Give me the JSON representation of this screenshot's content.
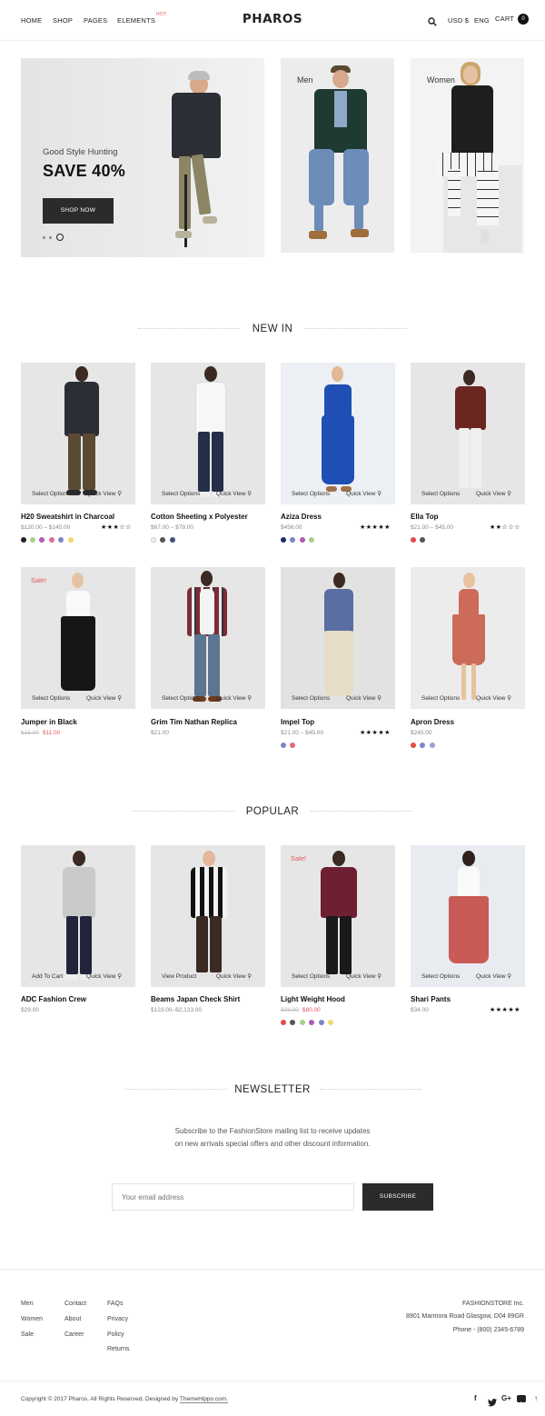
{
  "header": {
    "nav": [
      "HOME",
      "SHOP",
      "PAGES",
      "ELEMENTS"
    ],
    "hot_badge": "HOT",
    "logo": "PHAROS",
    "currency": "USD $",
    "language": "ENG",
    "cart_label": "CART",
    "cart_count": "0"
  },
  "hero": {
    "subtitle": "Good Style Hunting",
    "title": "SAVE 40%",
    "button": "SHOP NOW",
    "men_label": "Men",
    "women_label": "Women"
  },
  "sections": {
    "new_in": "NEW IN",
    "popular": "POPULAR",
    "newsletter": "NEWSLETTER"
  },
  "new_in": [
    {
      "name": "H20 Sweatshirt in Charcoal",
      "price": "$120.00 – $145.00",
      "stars": "★★★☆☆",
      "action": "Select Options",
      "quick": "Quick View",
      "swatches": [
        "#222222",
        "#a8d08d",
        "#b259b7",
        "#e36c9a",
        "#7f84c6",
        "#f5d76e"
      ]
    },
    {
      "name": "Cotton Sheeting x Polyester",
      "price": "$67.00 – $79.00",
      "action": "Select Options",
      "quick": "Quick View",
      "swatches": [
        "#f2f2f2",
        "#555555",
        "#44507a"
      ]
    },
    {
      "name": "Aziza Dress",
      "price": "$456.00",
      "stars": "★★★★★",
      "action": "Select Options",
      "quick": "Quick View",
      "swatches": [
        "#1d2c6b",
        "#7f84c6",
        "#b259b7",
        "#a8d08d"
      ]
    },
    {
      "name": "Ella Top",
      "price": "$21.00 – $45.00",
      "stars": "★★☆☆☆",
      "action": "Select Options",
      "quick": "Quick View",
      "swatches": [
        "#e04b4b",
        "#555555"
      ]
    },
    {
      "name": "Jumper in Black",
      "old_price": "$15.00",
      "new_price": "$11.00",
      "sale": "Sale!",
      "action": "Select Options",
      "quick": "Quick View"
    },
    {
      "name": "Grim Tim Nathan Replica",
      "price": "$21.00",
      "action": "Select Options",
      "quick": "Quick View"
    },
    {
      "name": "Impel Top",
      "price": "$21.00 – $45.00",
      "stars": "★★★★★",
      "action": "Select Options",
      "quick": "Quick View",
      "swatches": [
        "#7f84c6",
        "#e36c6c"
      ]
    },
    {
      "name": "Apron Dress",
      "price": "$245.00",
      "action": "Select Options",
      "quick": "Quick View",
      "swatches": [
        "#e04b4b",
        "#7f84c6",
        "#9aa3c9"
      ]
    }
  ],
  "popular": [
    {
      "name": "ADC Fashion Crew",
      "price": "$29.00",
      "action": "Add To Cart",
      "quick": "Quick View"
    },
    {
      "name": "Beams Japan Check Shirt",
      "price": "$123.00–$2,123.00",
      "action": "View Product",
      "quick": "Quick View"
    },
    {
      "name": "Light Weight Hood",
      "old_price": "$98.00",
      "new_price": "$80.00",
      "sale": "Sale!",
      "action": "Select Options",
      "quick": "Quick View",
      "swatches": [
        "#e04b4b",
        "#555555",
        "#a8d08d",
        "#b259b7",
        "#7f84c6",
        "#f5d76e"
      ]
    },
    {
      "name": "Shari Pants",
      "price": "$34.00",
      "stars": "★★★★★",
      "action": "Select Options",
      "quick": "Quick View"
    }
  ],
  "newsletter": {
    "text": "Subscribe to the FashionStore mailing list to receive updates on new arrivals special offers and other discount information.",
    "placeholder": "Your email address",
    "button": "SUBSCRIBE"
  },
  "footer": {
    "col1": [
      "Men",
      "Women",
      "Sale"
    ],
    "col2": [
      "Contact",
      "About",
      "Career"
    ],
    "col3": [
      "FAQs",
      "Privacy",
      "Policy",
      "Returns"
    ],
    "company": "FASHIONSTORE Inc.",
    "address": "8901 Marmora Road Glasgow, D04 89GR",
    "phone": "Phone - (800) 2345-6789",
    "copyright": "Copyright © 2017 Pharos. All Rights Reserved. Designed by",
    "designer": "ThemeHippo.com."
  }
}
